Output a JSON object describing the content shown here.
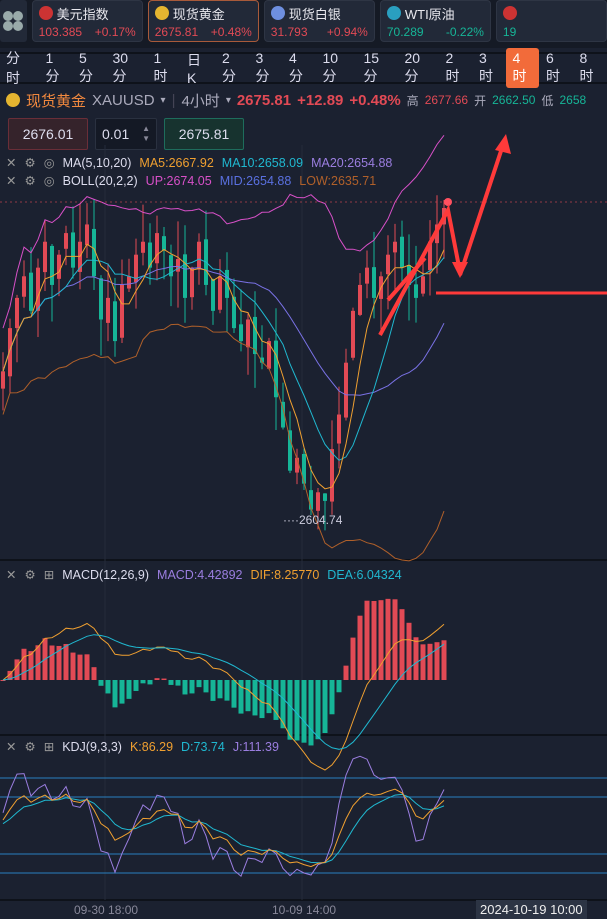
{
  "tickers": [
    {
      "name": "美元指数",
      "price": "103.385",
      "change": "+0.17%",
      "dir": "up",
      "icon": "us-flag-icon",
      "color": "#c33"
    },
    {
      "name": "现货黄金",
      "price": "2675.81",
      "change": "+0.48%",
      "dir": "up",
      "icon": "gold-icon",
      "color": "#e5b530"
    },
    {
      "name": "现货白银",
      "price": "31.793",
      "change": "+0.94%",
      "dir": "up",
      "icon": "silver-icon",
      "color": "#6e8fe0"
    },
    {
      "name": "WTI原油",
      "price": "70.289",
      "change": "-0.22%",
      "dir": "dn",
      "icon": "oil-icon",
      "color": "#2a9fc0"
    },
    {
      "name": "",
      "price": "19",
      "change": "",
      "dir": "dn",
      "icon": "uk-flag-icon",
      "color": "#c33"
    }
  ],
  "periods": [
    "分时",
    "1分",
    "5分",
    "30分",
    "1时",
    "日K",
    "2分",
    "3分",
    "4分",
    "10分",
    "15分",
    "20分",
    "2时",
    "3时",
    "4时",
    "6时",
    "8时"
  ],
  "active_period": "4时",
  "symbol": {
    "name": "现货黄金",
    "code": "XAUUSD",
    "interval": "4小时",
    "price": "2675.81",
    "change": "+12.89",
    "pct": "+0.48%",
    "high_label": "高",
    "high": "2677.66",
    "open_label": "开",
    "open": "2662.50",
    "low_label": "低",
    "low": "2658"
  },
  "trade": {
    "sell": "2676.01",
    "lot": "0.01",
    "buy": "2675.81"
  },
  "legend": {
    "ma": "MA(5,10,20)",
    "ma5": "MA5:2667.92",
    "ma10": "MA10:2658.09",
    "ma20": "MA20:2654.88",
    "boll": "BOLL(20,2,2)",
    "up": "UP:2674.05",
    "mid": "MID:2654.88",
    "low": "LOW:2635.71",
    "macd": "MACD(12,26,9)",
    "macd_v": "MACD:4.42892",
    "dif": "DIF:8.25770",
    "dea": "DEA:6.04324",
    "kdj": "KDJ(9,3,3)",
    "k": "K:86.29",
    "d": "D:73.74",
    "j": "J:111.39"
  },
  "low_marker": "2604.74",
  "xaxis": [
    "09-30 18:00",
    "10-09 14:00"
  ],
  "crosshair_time": "2024-10-19 10:00",
  "chart_data": {
    "type": "candlestick",
    "closes": [
      2638,
      2648,
      2655,
      2660,
      2652,
      2662,
      2668,
      2658,
      2665,
      2670,
      2662,
      2668,
      2672,
      2660,
      2650,
      2655,
      2645,
      2658,
      2660,
      2665,
      2668,
      2662,
      2670,
      2666,
      2660,
      2664,
      2655,
      2662,
      2668,
      2658,
      2652,
      2660,
      2655,
      2648,
      2645,
      2650,
      2642,
      2640,
      2645,
      2632,
      2625,
      2615,
      2618,
      2612,
      2606,
      2610,
      2608,
      2620,
      2628,
      2640,
      2652,
      2658,
      2662,
      2655,
      2660,
      2665,
      2668,
      2662,
      2658,
      2655,
      2660,
      2668,
      2672,
      2675.81
    ],
    "price_range": [
      2600,
      2686
    ]
  }
}
